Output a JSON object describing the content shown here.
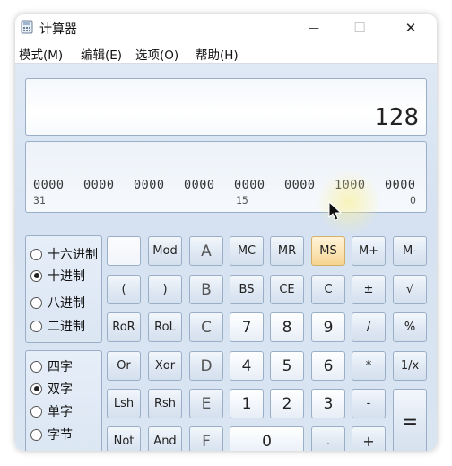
{
  "window": {
    "title": "计算器",
    "minimize_glyph": "—",
    "maximize_glyph": "☐",
    "close_glyph": "✕"
  },
  "menu": {
    "items": [
      "模式(M)",
      "编辑(E)",
      "选项(O)",
      "帮助(H)"
    ]
  },
  "display": {
    "value": "128"
  },
  "bits": {
    "groups": [
      "0000",
      "0000",
      "0000",
      "0000",
      "0000",
      "0000",
      "1000",
      "0000"
    ],
    "positions": [
      "31",
      "15",
      "0"
    ]
  },
  "base": {
    "options": [
      "十六进制",
      "十进制",
      "八进制",
      "二进制"
    ],
    "selected": "十进制"
  },
  "word": {
    "options": [
      "四字",
      "双字",
      "单字",
      "字节"
    ],
    "selected": "双字"
  },
  "buttons": {
    "r1": [
      "",
      "Mod",
      "A",
      "MC",
      "MR",
      "MS",
      "M+",
      "M-"
    ],
    "r2": [
      "(",
      ")",
      "B",
      "BS",
      "CE",
      "C",
      "±",
      "√"
    ],
    "r3": [
      "RoR",
      "RoL",
      "C",
      "7",
      "8",
      "9",
      "/",
      "%"
    ],
    "r4": [
      "Or",
      "Xor",
      "D",
      "4",
      "5",
      "6",
      "*",
      "1/x"
    ],
    "r5": [
      "Lsh",
      "Rsh",
      "E",
      "1",
      "2",
      "3",
      "-",
      "="
    ],
    "r6": [
      "Not",
      "And",
      "F",
      "0",
      ".",
      "+"
    ]
  }
}
